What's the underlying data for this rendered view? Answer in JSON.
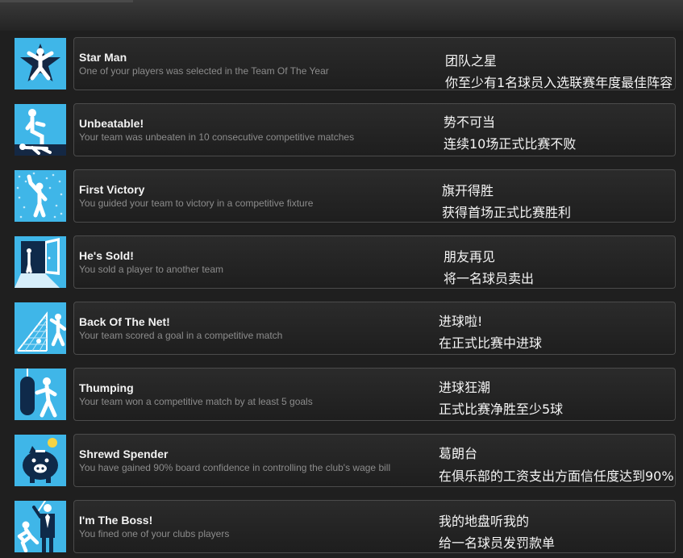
{
  "achievements": [
    {
      "title": "Star Man",
      "description": "One of your players was selected in the Team Of The Year",
      "zh_title": "团队之星",
      "zh_description": "你至少有1名球员入选联赛年度最佳阵容",
      "icon": "star-man-icon"
    },
    {
      "title": "Unbeatable!",
      "description": "Your team was unbeaten in 10 consecutive competitive matches",
      "zh_title": "势不可当",
      "zh_description": "连续10场正式比赛不败",
      "icon": "unbeatable-icon"
    },
    {
      "title": "First Victory",
      "description": "You guided your team to victory in a competitive fixture",
      "zh_title": "旗开得胜",
      "zh_description": "获得首场正式比赛胜利",
      "icon": "first-victory-icon"
    },
    {
      "title": "He's Sold!",
      "description": "You sold a player to another team",
      "zh_title": "朋友再见",
      "zh_description": "将一名球员卖出",
      "icon": "door-exit-icon"
    },
    {
      "title": "Back Of The Net!",
      "description": "Your team scored a goal in a competitive match",
      "zh_title": "进球啦!",
      "zh_description": "在正式比赛中进球",
      "icon": "goal-net-icon"
    },
    {
      "title": "Thumping",
      "description": "Your team won a competitive match by at least 5 goals",
      "zh_title": "进球狂潮",
      "zh_description": "正式比赛净胜至少5球",
      "icon": "punching-bag-icon"
    },
    {
      "title": "Shrewd Spender",
      "description": "You have gained 90% board confidence in controlling the club's wage bill",
      "zh_title": "葛朗台",
      "zh_description": "在俱乐部的工资支出方面信任度达到90%",
      "icon": "piggy-bank-icon"
    },
    {
      "title": "I'm The Boss!",
      "description": "You fined one of your clubs players",
      "zh_title": "我的地盘听我的",
      "zh_description": "给一名球员发罚款单",
      "icon": "boss-icon"
    }
  ]
}
